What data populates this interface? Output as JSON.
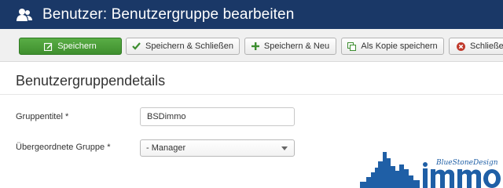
{
  "header": {
    "title": "Benutzer: Benutzergruppe bearbeiten",
    "icon": "users-icon"
  },
  "toolbar": {
    "save_label": "Speichern",
    "save_close_label": "Speichern & Schließen",
    "save_new_label": "Speichern & Neu",
    "save_copy_label": "Als Kopie speichern",
    "close_label": "Schließen",
    "colors": {
      "save": "#3f8f2e",
      "close_icon": "#c0392b",
      "check": "#3c8d2f"
    }
  },
  "form": {
    "section_title": "Benutzergruppendetails",
    "group_title_label": "Gruppentitel *",
    "group_title_value": "BSDimmo",
    "parent_group_label": "Übergeordnete Gruppe *",
    "parent_group_value": "- Manager"
  },
  "logo": {
    "script_text": "BlueStoneDesign",
    "word": "immo",
    "color": "#1f5fa6"
  }
}
